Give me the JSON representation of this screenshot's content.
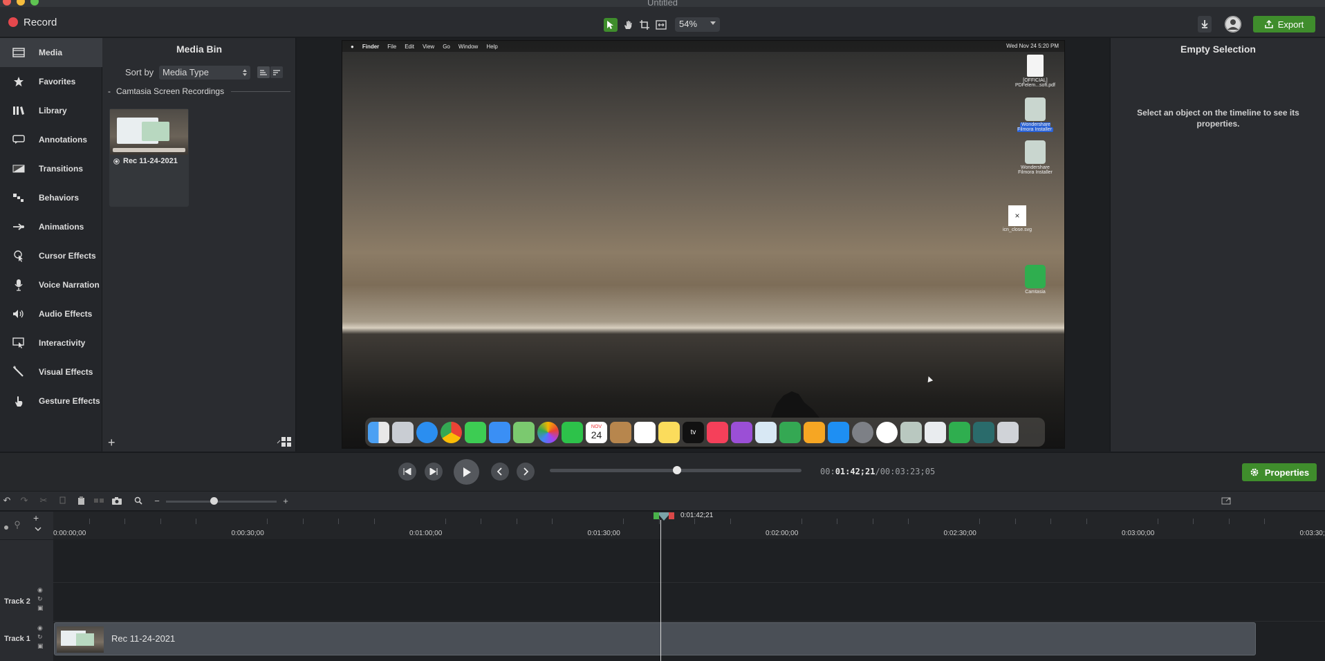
{
  "window": {
    "title": "Untitled"
  },
  "toolbar": {
    "record_label": "Record",
    "zoom_value": "54%",
    "export_label": "Export"
  },
  "nav": {
    "items": [
      {
        "label": "Media",
        "icon": "media-icon"
      },
      {
        "label": "Favorites",
        "icon": "star-icon"
      },
      {
        "label": "Library",
        "icon": "library-icon"
      },
      {
        "label": "Annotations",
        "icon": "annotations-icon"
      },
      {
        "label": "Transitions",
        "icon": "transitions-icon"
      },
      {
        "label": "Behaviors",
        "icon": "behaviors-icon"
      },
      {
        "label": "Animations",
        "icon": "animations-icon"
      },
      {
        "label": "Cursor Effects",
        "icon": "cursor-effects-icon"
      },
      {
        "label": "Voice Narration",
        "icon": "microphone-icon"
      },
      {
        "label": "Audio Effects",
        "icon": "speaker-icon"
      },
      {
        "label": "Interactivity",
        "icon": "interactivity-icon"
      },
      {
        "label": "Visual Effects",
        "icon": "magic-wand-icon"
      },
      {
        "label": "Gesture Effects",
        "icon": "hand-gesture-icon"
      }
    ]
  },
  "media_bin": {
    "title": "Media Bin",
    "sort_label": "Sort by",
    "sort_value": "Media Type",
    "group_label": "Camtasia Screen Recordings",
    "group_collapse": "-",
    "clip_name": "Rec 11-24-2021"
  },
  "canvas": {
    "menubar": [
      "Finder",
      "File",
      "Edit",
      "View",
      "Go",
      "Window",
      "Help"
    ],
    "clock": "Wed Nov 24  5:20 PM",
    "desktop_icons": [
      {
        "label": "[OFFICIAL] PDFelem...soft.pdf"
      },
      {
        "label": "Wondershare Filmora Installer"
      },
      {
        "label": "Wondershare Filmora Installer"
      },
      {
        "label": "icn_close.svg"
      },
      {
        "label": "Camtasia"
      }
    ],
    "dock_date_month": "NOV",
    "dock_date_day": "24",
    "dock_tv_label": "tv"
  },
  "properties": {
    "title": "Empty Selection",
    "message": "Select an object on the timeline to see its properties.",
    "button_label": "Properties"
  },
  "player": {
    "time_current": "01:42;21",
    "time_prefix": "00:",
    "time_total": "/00:03:23;05",
    "progress": 0.505
  },
  "timeline": {
    "playhead_label": "0:01:42;21",
    "ticks": [
      "0:00:00;00",
      "0:00:30;00",
      "0:01:00;00",
      "0:01:30;00",
      "0:02:00;00",
      "0:02:30;00",
      "0:03:00;00",
      "0:03:30;00"
    ],
    "tracks": [
      {
        "label": "Track 2"
      },
      {
        "label": "Track 1",
        "clip_label": "Rec 11-24-2021"
      }
    ]
  },
  "colors": {
    "accent_green": "#3f8d2c",
    "record_red": "#e5484d"
  }
}
